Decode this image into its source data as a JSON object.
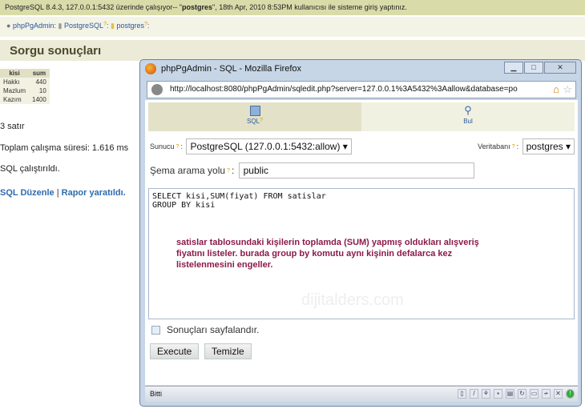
{
  "topbar": {
    "pre": "PostgreSQL 8.4.3, 127.0.0.1:5432 üzerinde çalışıyor-- \"",
    "user": "postgres",
    "post": "\", 18th Apr, 2010 8:53PM kullanıcısı ile sisteme giriş yaptınız."
  },
  "breadcrumb": {
    "app": "phpPgAdmin",
    "server": "PostgreSQL",
    "db": "postgres",
    "sep": ":",
    "help": "?"
  },
  "page_title": "Sorgu sonuçları",
  "results": {
    "columns": [
      "kisi",
      "sum"
    ],
    "rows": [
      [
        "Hakkı",
        "440"
      ],
      [
        "Mazlum",
        "10"
      ],
      [
        "Kazım",
        "1400"
      ]
    ]
  },
  "row_count": "3 satır",
  "runtime": "Toplam çalışma süresi: 1.616 ms",
  "executed": "SQL çalıştırıldı.",
  "links": {
    "edit": "SQL Düzenle",
    "report": "Rapor yaratıldı."
  },
  "popup": {
    "title": "phpPgAdmin - SQL - Mozilla Firefox",
    "url": "http://localhost:8080/phpPgAdmin/sqledit.php?server=127.0.0.1%3A5432%3Aallow&database=po",
    "tabs": [
      {
        "label": "SQL"
      },
      {
        "label": "Bul"
      }
    ],
    "server_label": "Sunucu",
    "server_value": "PostgreSQL (127.0.0.1:5432:allow)",
    "db_label": "Veritabanı",
    "db_value": "postgres",
    "schema_label": "Şema arama yolu",
    "schema_value": "public",
    "sql": "SELECT kisi,SUM(fiyat) FROM satislar\nGROUP BY kisi",
    "note": "satislar tablosundaki kişilerin toplamda (SUM) yapmış oldukları alışveriş fiyatını listeler. burada group by komutu aynı kişinin defalarca kez listelenmesini engeller.",
    "watermark": "dijitalders.com",
    "paginate_label": "Sonuçları sayfalandır.",
    "execute": "Execute",
    "clear": "Temizle",
    "status": "Bitti"
  }
}
